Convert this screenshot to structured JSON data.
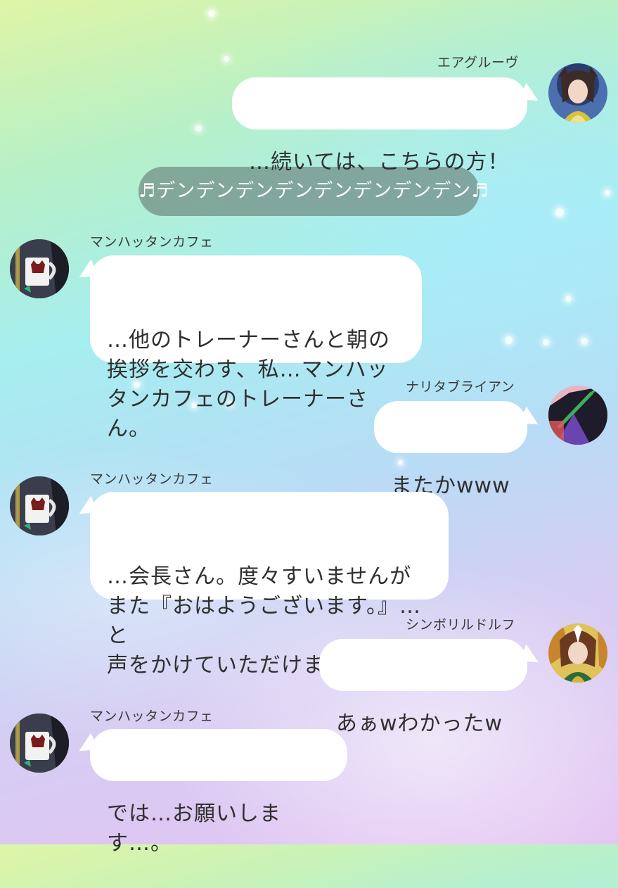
{
  "sound_effect": {
    "text": "♬デンデンデンデンデンデンデンデン♬"
  },
  "messages": [
    {
      "sender": "エアグルーヴ",
      "text": "…続いては、こちらの方！",
      "side": "right",
      "avatar_icon": "air-groove-avatar-icon"
    },
    {
      "sender": "マンハッタンカフェ",
      "text": "…他のトレーナーさんと朝の\n挨拶を交わす、私…マンハッ\nタンカフェのトレーナーさん。",
      "side": "left",
      "avatar_icon": "manhattan-cafe-mug-avatar-icon"
    },
    {
      "sender": "ナリタブライアン",
      "text": "またかwww",
      "side": "right",
      "avatar_icon": "narita-brian-avatar-icon"
    },
    {
      "sender": "マンハッタンカフェ",
      "text": "…会長さん。度々すいませんが\nまた『おはようございます。』…と\n声をかけていただけますか…？",
      "side": "left",
      "avatar_icon": "manhattan-cafe-mug-avatar-icon"
    },
    {
      "sender": "シンボリルドルフ",
      "text": "あぁwわかったw",
      "side": "right",
      "avatar_icon": "symboli-rudolf-avatar-icon"
    },
    {
      "sender": "マンハッタンカフェ",
      "text": "では…お願いします…。",
      "side": "left",
      "avatar_icon": "manhattan-cafe-mug-avatar-icon"
    }
  ],
  "colors": {
    "bubble": "#ffffff",
    "text": "#2f2f2f",
    "sfx_bubble": "#708a82"
  }
}
